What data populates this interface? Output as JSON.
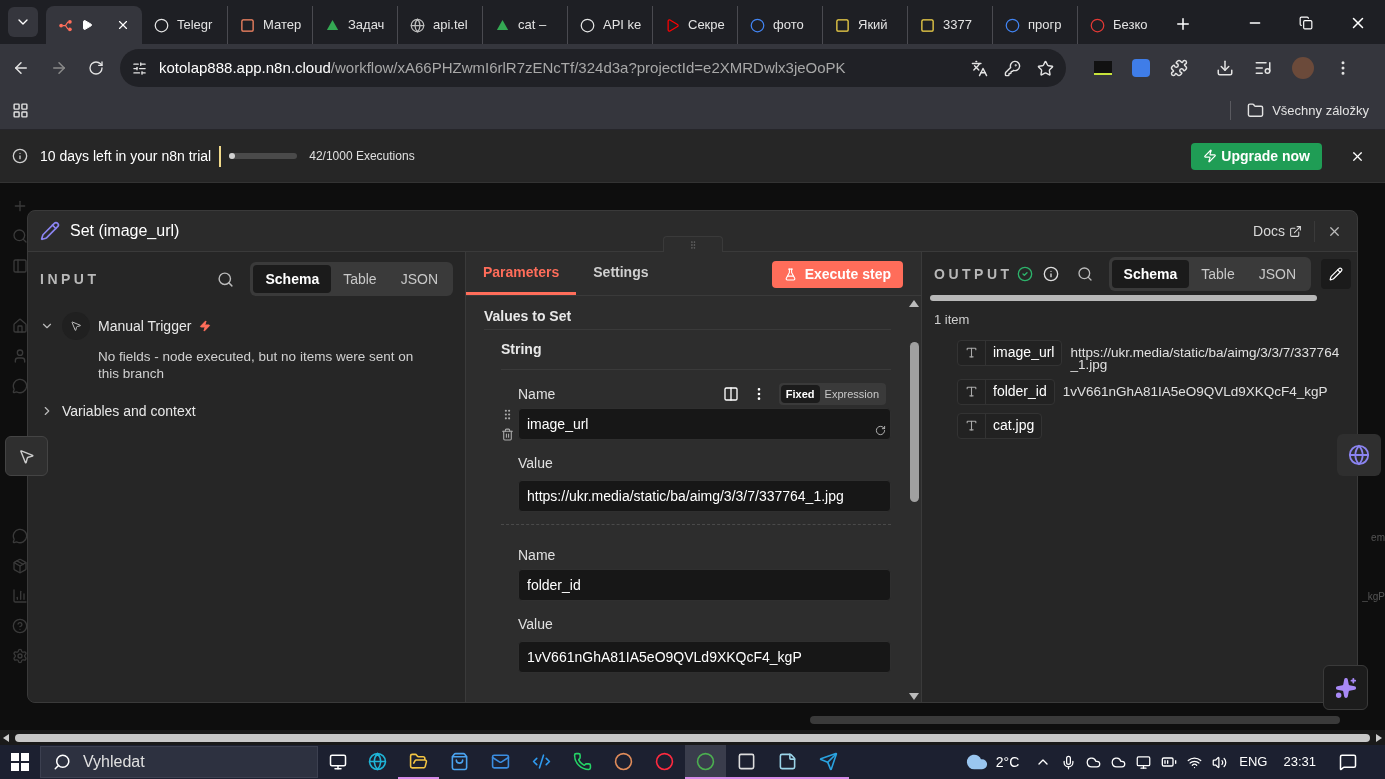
{
  "browser": {
    "tabs": [
      {
        "kind": "nodes",
        "selected": true,
        "playing": true
      },
      {
        "kind": "knot",
        "label": "Telegr",
        "selected": false
      },
      {
        "kind": "square",
        "label": "Матер",
        "selected": false
      },
      {
        "kind": "triangle",
        "label": "Задач",
        "selected": false
      },
      {
        "kind": "globe",
        "label": "api.tel",
        "selected": false
      },
      {
        "kind": "triangle",
        "label": "cat –",
        "selected": false
      },
      {
        "kind": "knot",
        "label": "API ke",
        "selected": false
      },
      {
        "kind": "play",
        "label": "Секре",
        "selected": false
      },
      {
        "kind": "letter",
        "label": "фото",
        "selected": false
      },
      {
        "kind": "photo",
        "label": "Який",
        "selected": false
      },
      {
        "kind": "photo",
        "label": "3377",
        "selected": false
      },
      {
        "kind": "letter",
        "label": "прогр",
        "selected": false
      },
      {
        "kind": "record",
        "label": "Безко",
        "selected": false
      }
    ],
    "address": {
      "host": "kotolap888.app.n8n.cloud",
      "path": "/workflow/xA66PHZwmI6rlR7zENcTf/324d3a?projectId=e2XMRDwlx3jeOoPK"
    },
    "bookmarks_label": "Všechny záložky"
  },
  "trial_banner": {
    "message": "10 days left in your n8n trial",
    "level": 0.042,
    "executions": "42/1000 Executions",
    "upgrade": "Upgrade now"
  },
  "node": {
    "title": "Set (image_url)",
    "docs": "Docs"
  },
  "input": {
    "heading": "INPUT",
    "views": [
      {
        "label": "Schema",
        "selected": true
      },
      {
        "label": "Table",
        "selected": false
      },
      {
        "label": "JSON",
        "selected": false
      }
    ],
    "tree": [
      {
        "label": "Manual Trigger",
        "expanded": true,
        "message": "No fields - node executed, but no items were sent on this branch"
      },
      {
        "label": "Variables and context",
        "expanded": false
      }
    ]
  },
  "parameters": {
    "tabs": [
      {
        "label": "Parameters",
        "selected": true
      },
      {
        "label": "Settings",
        "selected": false
      }
    ],
    "execute": "Execute step",
    "section": "Values to Set",
    "group": "String",
    "assignments": [
      {
        "name_label": "Name",
        "name": "image_url",
        "value_label": "Value",
        "value": "https://ukr.media/static/ba/aimg/3/3/7/337764_1.jpg",
        "hovered": true,
        "modes": [
          {
            "label": "Fixed",
            "selected": true
          },
          {
            "label": "Expression",
            "selected": false
          }
        ]
      },
      {
        "name_label": "Name",
        "name": "folder_id",
        "value_label": "Value",
        "value": "1vV661nGhA81IA5eO9QVLd9XKQcF4_kgP",
        "hovered": false
      }
    ]
  },
  "output": {
    "heading": "OUTPUT",
    "views": [
      {
        "label": "Schema",
        "selected": true
      },
      {
        "label": "Table",
        "selected": false
      },
      {
        "label": "JSON",
        "selected": false
      }
    ],
    "count": "1 item",
    "fields": [
      {
        "name": "image_url",
        "value": "https://ukr.media/static/ba/aimg/3/3/7/337764_1.jpg"
      },
      {
        "name": "folder_id",
        "value": "1vV661nGhA81IA5eO9QVLd9XKQcF4_kgP"
      },
      {
        "name": "cat.jpg"
      }
    ]
  },
  "background_fragments": [
    "em",
    "_kgP"
  ],
  "taskbar": {
    "search_placeholder": "Vyhledat",
    "apps": [
      {
        "kind": "wave",
        "active": false
      },
      {
        "kind": "folder",
        "active": true
      },
      {
        "kind": "bag",
        "active": false
      },
      {
        "kind": "mail",
        "active": false
      },
      {
        "kind": "code",
        "active": false
      },
      {
        "kind": "phone",
        "active": false
      },
      {
        "kind": "swirl",
        "active": false
      },
      {
        "kind": "ring",
        "active": false
      },
      {
        "kind": "chrome",
        "active": true
      },
      {
        "kind": "square",
        "active": true
      },
      {
        "kind": "note",
        "active": true
      },
      {
        "kind": "send",
        "active": true
      }
    ],
    "weather": "2°C",
    "language": "ENG",
    "time": "23:31"
  }
}
